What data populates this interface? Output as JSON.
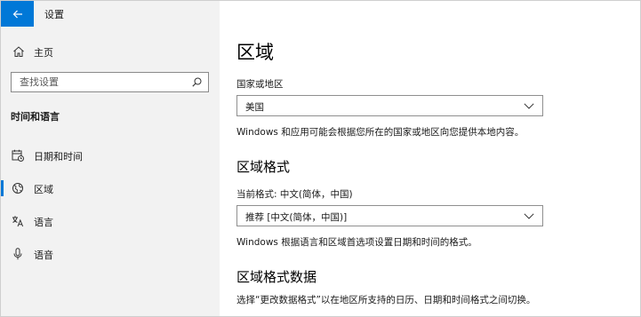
{
  "window": {
    "title": "设置"
  },
  "sidebar": {
    "home_label": "主页",
    "search_placeholder": "查找设置",
    "section_heading": "时间和语言",
    "items": [
      {
        "label": "日期和时间",
        "icon": "calendar-clock-icon",
        "selected": false
      },
      {
        "label": "区域",
        "icon": "globe-region-icon",
        "selected": true
      },
      {
        "label": "语言",
        "icon": "language-icon",
        "selected": false
      },
      {
        "label": "语音",
        "icon": "microphone-icon",
        "selected": false
      }
    ]
  },
  "main": {
    "title": "区域",
    "country": {
      "label": "国家或地区",
      "value": "美国",
      "description": "Windows 和应用可能会根据您所在的国家或地区向您提供本地内容。"
    },
    "regional_format": {
      "heading": "区域格式",
      "current_label": "当前格式: 中文(简体，中国)",
      "value": "推荐 [中文(简体，中国)]",
      "description": "Windows 根据语言和区域首选项设置日期和时间的格式。"
    },
    "format_data": {
      "heading": "区域格式数据",
      "description": "选择“更改数据格式”以在地区所支持的日历、日期和时间格式之间切换。"
    }
  },
  "colors": {
    "accent": "#0078d7",
    "sidebar_bg": "#f2f2f2",
    "main_bg": "#ffffff",
    "text": "#1a1a1a"
  }
}
